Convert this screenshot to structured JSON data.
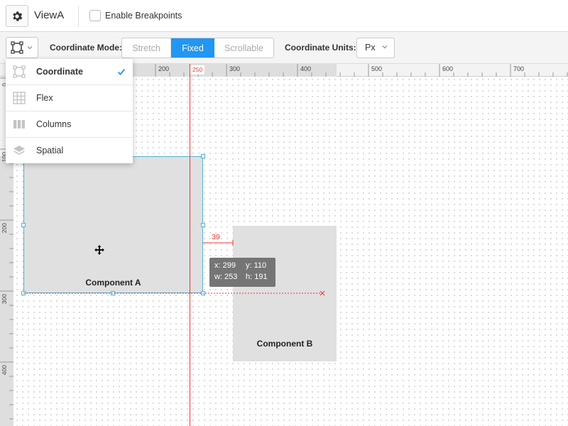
{
  "header": {
    "view_title": "ViewA",
    "breakpoints_label": "Enable Breakpoints",
    "breakpoints_checked": false
  },
  "toolbar": {
    "coordinate_mode_label": "Coordinate Mode:",
    "modes": [
      "Stretch",
      "Fixed",
      "Scrollable"
    ],
    "active_mode": "Fixed",
    "coordinate_units_label": "Coordinate Units:",
    "units_value": "Px"
  },
  "layout_menu": {
    "items": [
      {
        "label": "Coordinate",
        "icon": "coordinate-layout-icon",
        "selected": true
      },
      {
        "label": "Flex",
        "icon": "flex-grid-icon",
        "selected": false
      },
      {
        "label": "Columns",
        "icon": "columns-icon",
        "selected": false
      },
      {
        "label": "Spatial",
        "icon": "layers-icon",
        "selected": false
      }
    ]
  },
  "ruler": {
    "top_ticks": [
      "200",
      "300",
      "400",
      "500",
      "600",
      "700"
    ],
    "left_ticks": [
      "0",
      "100",
      "200",
      "300",
      "400"
    ],
    "guide_marker": "250"
  },
  "canvas": {
    "component_a": {
      "label": "Component A"
    },
    "component_b": {
      "label": "Component B"
    },
    "distance_label": "39",
    "tooltip": {
      "x": "x: 299",
      "y": "y: 110",
      "w": "w: 253",
      "h": "h: 191"
    }
  },
  "colors": {
    "accent": "#2196f3",
    "guide": "#e53935",
    "selection": "#4fb3d9"
  }
}
